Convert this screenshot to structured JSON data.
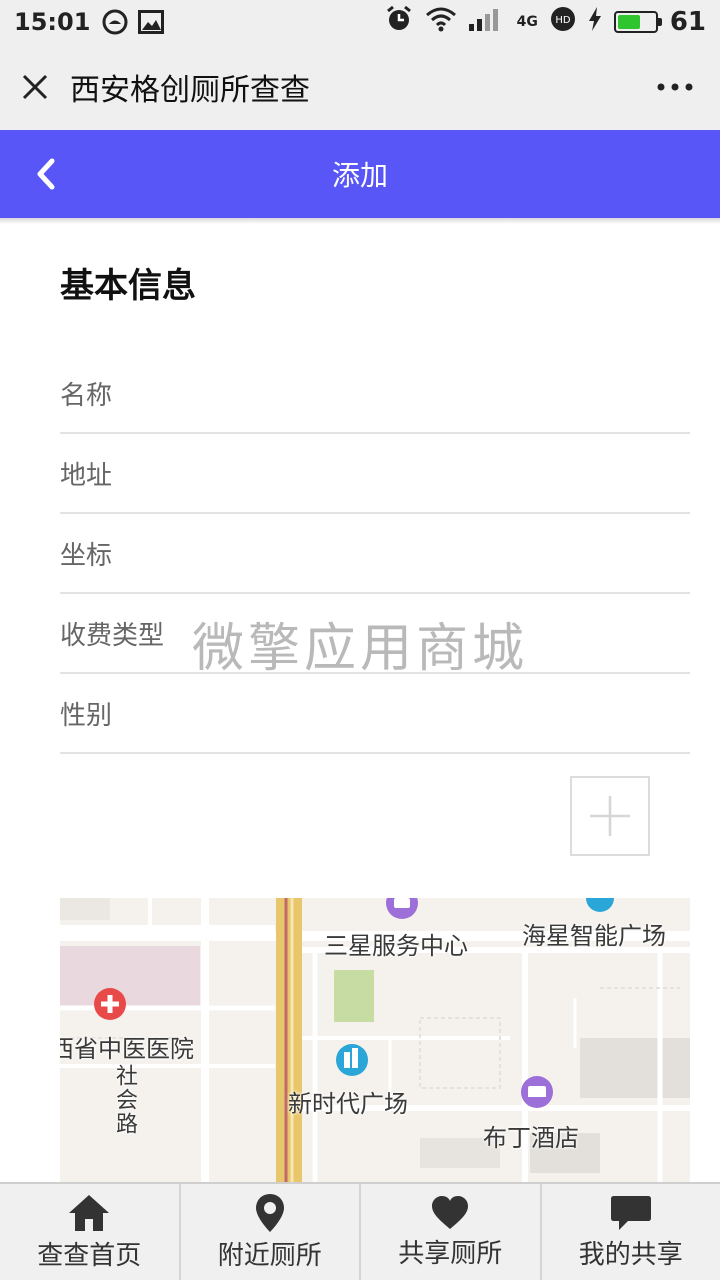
{
  "status_bar": {
    "time": "15:01",
    "network": "4G",
    "battery_percent": "61",
    "battery_level": 0.61,
    "icons": [
      "chat-bubble-icon",
      "image-icon",
      "alarm-icon",
      "wifi-icon",
      "signal-icon",
      "hd-icon",
      "charging-icon",
      "battery-icon"
    ]
  },
  "wechat_bar": {
    "title": "西安格创厕所查查",
    "close_icon": "close-icon",
    "more_icon": "more-icon"
  },
  "app_header": {
    "title": "添加",
    "back_icon": "back-icon",
    "color": "#5856f7"
  },
  "form": {
    "section_title": "基本信息",
    "fields": [
      {
        "placeholder": "名称"
      },
      {
        "placeholder": "地址"
      },
      {
        "placeholder": "坐标"
      },
      {
        "placeholder": "收费类型"
      },
      {
        "placeholder": "性别"
      }
    ],
    "add_icon": "plus-icon"
  },
  "watermark": "微擎应用商城",
  "map": {
    "labels": {
      "samsung": "三星服务中心",
      "haixing": "海星智能广场",
      "hospital": "西省中医医院",
      "xinshidai": "新时代广场",
      "buding": "布丁酒店",
      "road": "社会路"
    }
  },
  "tabbar": {
    "items": [
      {
        "label": "查查首页",
        "icon": "home-icon"
      },
      {
        "label": "附近厕所",
        "icon": "location-pin-icon"
      },
      {
        "label": "共享厕所",
        "icon": "heart-icon"
      },
      {
        "label": "我的共享",
        "icon": "message-icon"
      }
    ]
  }
}
